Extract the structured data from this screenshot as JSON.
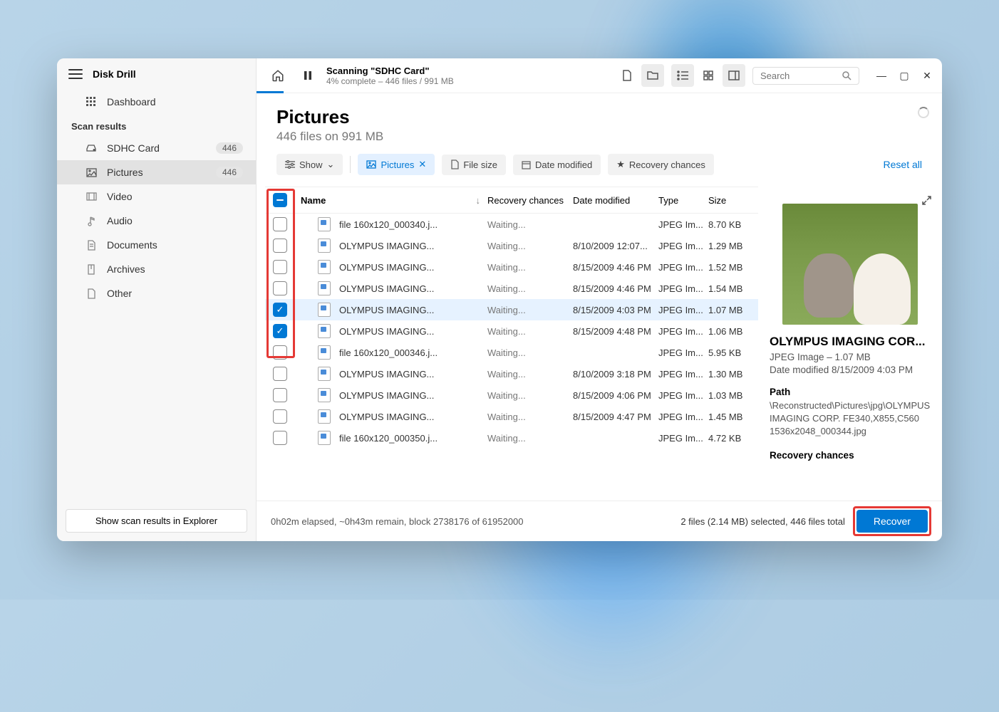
{
  "app": {
    "title": "Disk Drill"
  },
  "sidebar": {
    "dashboard": "Dashboard",
    "section": "Scan results",
    "items": [
      {
        "icon": "drive",
        "label": "SDHC Card",
        "badge": "446"
      },
      {
        "icon": "picture",
        "label": "Pictures",
        "badge": "446",
        "active": true
      },
      {
        "icon": "video",
        "label": "Video"
      },
      {
        "icon": "audio",
        "label": "Audio"
      },
      {
        "icon": "document",
        "label": "Documents"
      },
      {
        "icon": "archive",
        "label": "Archives"
      },
      {
        "icon": "other",
        "label": "Other"
      }
    ],
    "explorer_btn": "Show scan results in Explorer"
  },
  "topbar": {
    "scan_title": "Scanning \"SDHC Card\"",
    "scan_sub": "4% complete – 446 files / 991 MB",
    "search_placeholder": "Search"
  },
  "content": {
    "title": "Pictures",
    "subtitle": "446 files on 991 MB"
  },
  "filters": {
    "show": "Show",
    "pictures": "Pictures",
    "file_size": "File size",
    "date_modified": "Date modified",
    "recovery_chances": "Recovery chances",
    "reset": "Reset all"
  },
  "columns": {
    "name": "Name",
    "recovery": "Recovery chances",
    "date": "Date modified",
    "type": "Type",
    "size": "Size"
  },
  "files": [
    {
      "checked": false,
      "name": "file 160x120_000340.j...",
      "recovery": "Waiting...",
      "date": "",
      "type": "JPEG Im...",
      "size": "8.70 KB"
    },
    {
      "checked": false,
      "name": "OLYMPUS IMAGING...",
      "recovery": "Waiting...",
      "date": "8/10/2009 12:07...",
      "type": "JPEG Im...",
      "size": "1.29 MB"
    },
    {
      "checked": false,
      "name": "OLYMPUS IMAGING...",
      "recovery": "Waiting...",
      "date": "8/15/2009 4:46 PM",
      "type": "JPEG Im...",
      "size": "1.52 MB"
    },
    {
      "checked": false,
      "name": "OLYMPUS IMAGING...",
      "recovery": "Waiting...",
      "date": "8/15/2009 4:46 PM",
      "type": "JPEG Im...",
      "size": "1.54 MB"
    },
    {
      "checked": true,
      "selected": true,
      "name": "OLYMPUS IMAGING...",
      "recovery": "Waiting...",
      "date": "8/15/2009 4:03 PM",
      "type": "JPEG Im...",
      "size": "1.07 MB"
    },
    {
      "checked": true,
      "name": "OLYMPUS IMAGING...",
      "recovery": "Waiting...",
      "date": "8/15/2009 4:48 PM",
      "type": "JPEG Im...",
      "size": "1.06 MB"
    },
    {
      "checked": false,
      "name": "file 160x120_000346.j...",
      "recovery": "Waiting...",
      "date": "",
      "type": "JPEG Im...",
      "size": "5.95 KB"
    },
    {
      "checked": false,
      "name": "OLYMPUS IMAGING...",
      "recovery": "Waiting...",
      "date": "8/10/2009 3:18 PM",
      "type": "JPEG Im...",
      "size": "1.30 MB"
    },
    {
      "checked": false,
      "name": "OLYMPUS IMAGING...",
      "recovery": "Waiting...",
      "date": "8/15/2009 4:06 PM",
      "type": "JPEG Im...",
      "size": "1.03 MB"
    },
    {
      "checked": false,
      "name": "OLYMPUS IMAGING...",
      "recovery": "Waiting...",
      "date": "8/15/2009 4:47 PM",
      "type": "JPEG Im...",
      "size": "1.45 MB"
    },
    {
      "checked": false,
      "name": "file 160x120_000350.j...",
      "recovery": "Waiting...",
      "date": "",
      "type": "JPEG Im...",
      "size": "4.72 KB"
    }
  ],
  "preview": {
    "title": "OLYMPUS IMAGING COR...",
    "meta1": "JPEG Image – 1.07 MB",
    "meta2": "Date modified 8/15/2009 4:03 PM",
    "path_label": "Path",
    "path": "\\Reconstructed\\Pictures\\jpg\\OLYMPUS IMAGING CORP. FE340,X855,C560 1536x2048_000344.jpg",
    "recovery_label": "Recovery chances"
  },
  "footer": {
    "elapsed": "0h02m elapsed, ~0h43m remain, block 2738176 of 61952000",
    "selected": "2 files (2.14 MB) selected, 446 files total",
    "recover": "Recover"
  }
}
